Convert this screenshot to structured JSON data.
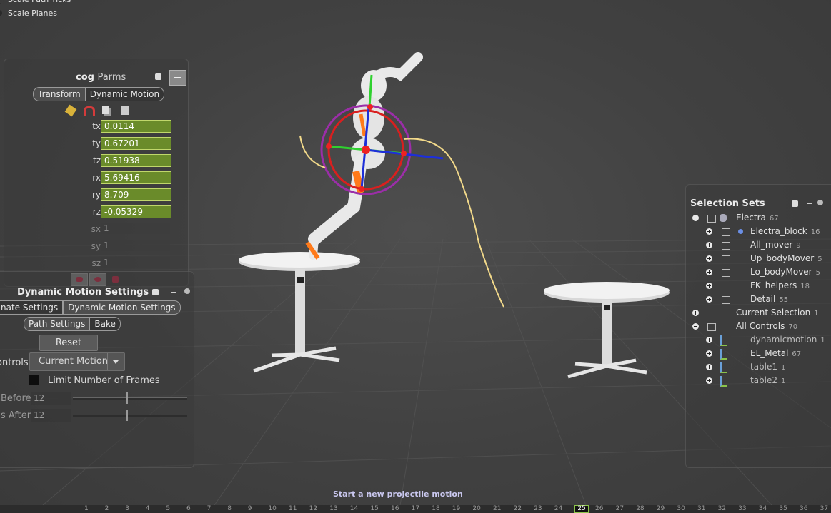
{
  "viewport": {
    "top_options": [
      "Scale Path Ticks",
      "Scale Planes"
    ],
    "status_text": "Start a new projectile motion"
  },
  "cog_parms": {
    "title_bold": "cog",
    "title_rest": "Parms",
    "tabs": [
      "Transform",
      "Dynamic Motion"
    ],
    "selected_tab": "Transform",
    "params": [
      {
        "label": "tx",
        "value": "0.0114",
        "active": true
      },
      {
        "label": "ty",
        "value": "0.67201",
        "active": true
      },
      {
        "label": "tz",
        "value": "0.51938",
        "active": true
      },
      {
        "label": "rx",
        "value": "5.69416",
        "active": true
      },
      {
        "label": "ry",
        "value": "8.709",
        "active": true
      },
      {
        "label": "rz",
        "value": "-0.05329",
        "active": true
      },
      {
        "label": "sx",
        "value": "1",
        "active": false
      },
      {
        "label": "sy",
        "value": "1",
        "active": false
      },
      {
        "label": "sz",
        "value": "1",
        "active": false
      }
    ],
    "field_color": "#6a8b2a"
  },
  "dms": {
    "title": "Dynamic Motion Settings",
    "tabs": [
      "nate Settings",
      "Dynamic Motion Settings"
    ],
    "subtabs": [
      "Path Settings",
      "Bake"
    ],
    "reset_label": "Reset",
    "controls_label": "ontrols",
    "controls_value": "Current Motion",
    "limit_label": "Limit Number of Frames",
    "limit_checked": false,
    "before_label": "Before",
    "before_value": "12",
    "after_label": "s After",
    "after_value": "12"
  },
  "selection_sets": {
    "title": "Selection Sets",
    "rows": [
      {
        "label": "Electra",
        "count": "67"
      },
      {
        "label": "Electra_block",
        "count": "16"
      },
      {
        "label": "All_mover",
        "count": "9"
      },
      {
        "label": "Up_bodyMover",
        "count": "5"
      },
      {
        "label": "Lo_bodyMover",
        "count": "5"
      },
      {
        "label": "FK_helpers",
        "count": "18"
      },
      {
        "label": "Detail",
        "count": "55"
      },
      {
        "label": "Current Selection",
        "count": "1"
      },
      {
        "label": "All Controls",
        "count": "70"
      },
      {
        "label": "dynamicmotion",
        "count": "1"
      },
      {
        "label": "EL_Metal",
        "count": "67"
      },
      {
        "label": "table1",
        "count": "1"
      },
      {
        "label": "table2",
        "count": "1"
      }
    ]
  },
  "timeline": {
    "frames": [
      "1",
      "2",
      "3",
      "4",
      "5",
      "6",
      "7",
      "8",
      "9",
      "10",
      "11",
      "12",
      "13",
      "14",
      "15",
      "16",
      "17",
      "18",
      "19",
      "20",
      "21",
      "22",
      "23",
      "24",
      "25",
      "26",
      "27",
      "28",
      "29",
      "30",
      "31",
      "32",
      "33",
      "34",
      "35",
      "36",
      "37"
    ],
    "current_frame": "25"
  }
}
